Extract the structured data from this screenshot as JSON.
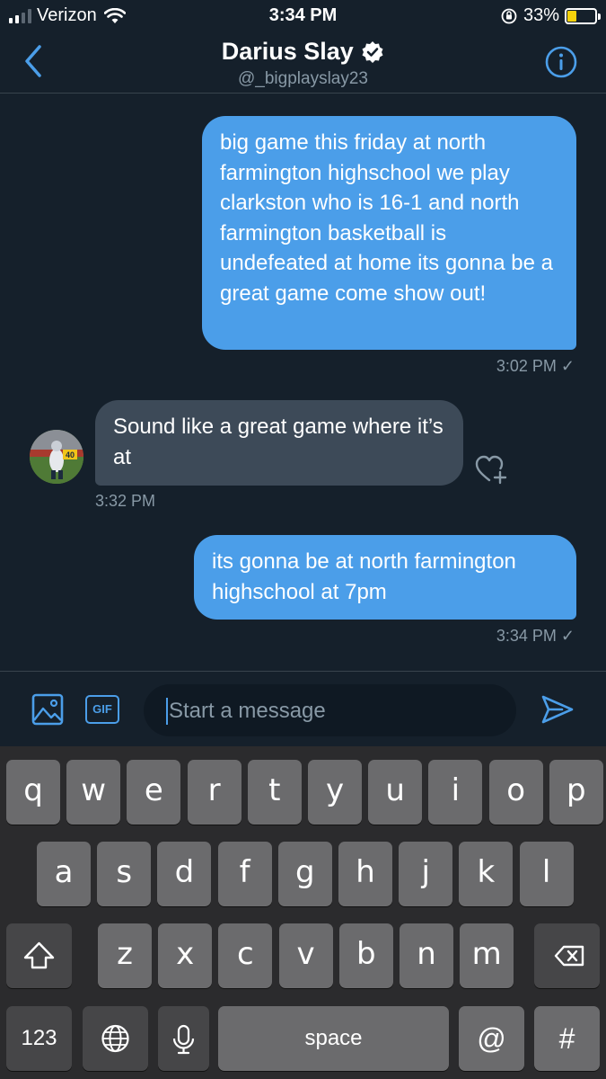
{
  "status_bar": {
    "carrier": "Verizon",
    "time": "3:34 PM",
    "battery_percent": "33%",
    "battery_level": 0.33,
    "battery_color": "#f5d20c"
  },
  "header": {
    "name": "Darius Slay",
    "handle": "@_bigplayslay23",
    "back_icon": "chevron-left-icon",
    "info_icon": "info-icon",
    "verified_icon": "verified-badge-icon"
  },
  "messages": [
    {
      "direction": "outgoing",
      "text": "big game this friday at north farmington highschool we play clarkston who is 16-1 and north farmington basketball is undefeated at home its gonna be a great game come show out!",
      "time": "3:02 PM ✓"
    },
    {
      "direction": "incoming",
      "text": "Sound like a great game where it’s at",
      "time": "3:32 PM"
    },
    {
      "direction": "outgoing",
      "text": "its gonna be at north farmington highschool at 7pm",
      "time": "3:34 PM ✓"
    }
  ],
  "composer": {
    "placeholder": "Start a message",
    "gif_label": "GIF",
    "image_icon": "image-icon",
    "send_icon": "send-icon"
  },
  "keyboard": {
    "row1": [
      "q",
      "w",
      "e",
      "r",
      "t",
      "y",
      "u",
      "i",
      "o",
      "p"
    ],
    "row2": [
      "a",
      "s",
      "d",
      "f",
      "g",
      "h",
      "j",
      "k",
      "l"
    ],
    "row3": [
      "z",
      "x",
      "c",
      "v",
      "b",
      "n",
      "m"
    ],
    "numbers_label": "123",
    "space_label": "space",
    "at_label": "@",
    "hash_label": "#",
    "shift_icon": "shift-icon",
    "delete_icon": "backspace-icon",
    "globe_icon": "globe-icon",
    "mic_icon": "microphone-icon"
  },
  "colors": {
    "background": "#15202b",
    "accent": "#4b9ee9",
    "incoming_bubble": "#3d4a58",
    "secondary_text": "#8899a6"
  }
}
